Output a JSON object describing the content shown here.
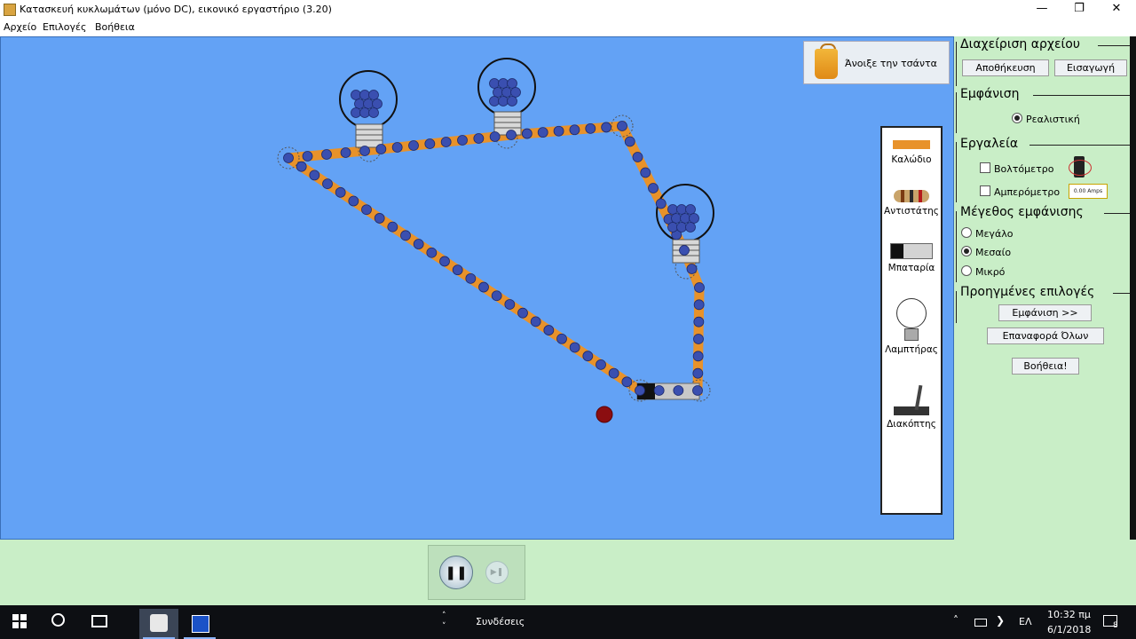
{
  "window": {
    "title": "Κατασκευή κυκλωμάτων (μόνο DC), εικονικό εργαστήριο (3.20)",
    "minimize_icon": "minimize-icon",
    "maximize_icon": "restore-icon",
    "close_icon": "close-icon"
  },
  "menu": {
    "file": "Αρχείο",
    "options": "Επιλογές",
    "help": "Βοήθεια"
  },
  "canvas": {
    "bag_label": "Άνοιξε την τσάντα",
    "background_color": "#63a2f5",
    "wire_color": "#e8922a",
    "electron_color": "#3a4fb0"
  },
  "toolbox": {
    "wire": "Καλώδιο",
    "resistor": "Αντιστάτης",
    "battery": "Μπαταρία",
    "bulb": "Λαμπτήρας",
    "switch": "Διακόπτης"
  },
  "panel": {
    "file_section": "Διαχείριση αρχείου",
    "save_button": "Αποθήκευση",
    "load_button": "Εισαγωγή",
    "view_section": "Εμφάνιση",
    "realistic_option": "Ρεαλιστική",
    "realistic_selected": true,
    "tools_section": "Εργαλεία",
    "voltmeter": "Βολτόμετρο",
    "voltmeter_checked": false,
    "ammeter": "Αμπερόμετρο",
    "ammeter_checked": false,
    "ammeter_readout": "0.00 Amps",
    "size_section": "Μέγεθος εμφάνισης",
    "size_large": "Μεγάλο",
    "size_medium": "Μεσαίο",
    "size_small": "Μικρό",
    "size_selected": "Μεσαίο",
    "advanced_section": "Προηγμένες επιλογές",
    "show_button": "Εμφάνιση >>",
    "reset_all_button": "Επαναφορά Όλων",
    "help_button": "Βοήθεια!"
  },
  "playback": {
    "pause_icon": "pause-icon",
    "step_icon": "step-icon",
    "paused": false
  },
  "taskbar": {
    "search_icon": "search-icon",
    "links_label": "Συνδέσεις",
    "language": "ΕΛ",
    "time": "10:32 πμ",
    "date": "6/1/2018",
    "notification_count": "8"
  }
}
